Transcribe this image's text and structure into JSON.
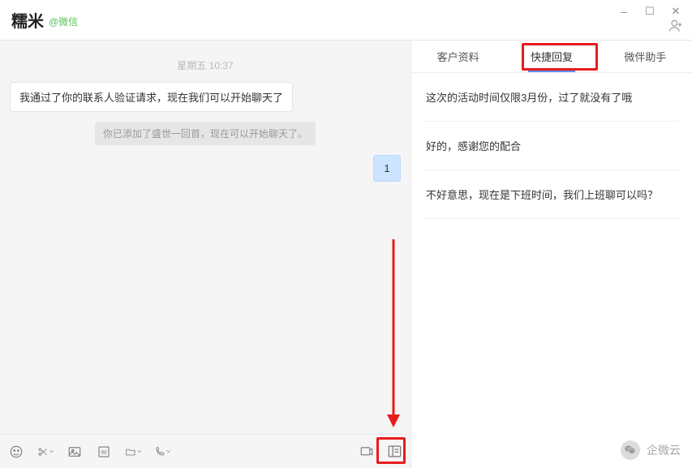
{
  "window": {
    "minimize": "–",
    "maximize": "☐",
    "close": "✕"
  },
  "header": {
    "contact_name": "糯米",
    "source_tag": "@微信"
  },
  "chat": {
    "timestamp": "星期五 10:37",
    "messages": [
      {
        "kind": "left",
        "text": "我通过了你的联系人验证请求，现在我们可以开始聊天了"
      },
      {
        "kind": "system",
        "text": "你已添加了盛世一回首，现在可以开始聊天了。"
      },
      {
        "kind": "right",
        "text": "1"
      }
    ]
  },
  "toolbar": {
    "icons": {
      "emoji": "表情",
      "scissors": "截图",
      "image": "图片",
      "wfile": "文件",
      "folder": "文件夹",
      "phone": "通话",
      "record": "录屏",
      "quickreply": "快捷回复"
    }
  },
  "panel": {
    "tabs": {
      "customer": "客户资料",
      "quick": "快捷回复",
      "assistant": "微伴助手"
    },
    "quick_replies": [
      "这次的活动时间仅限3月份，过了就没有了哦",
      "好的，感谢您的配合",
      "不好意思，现在是下班时间，我们上班聊可以吗？"
    ]
  },
  "watermark": {
    "label": "企微云"
  }
}
